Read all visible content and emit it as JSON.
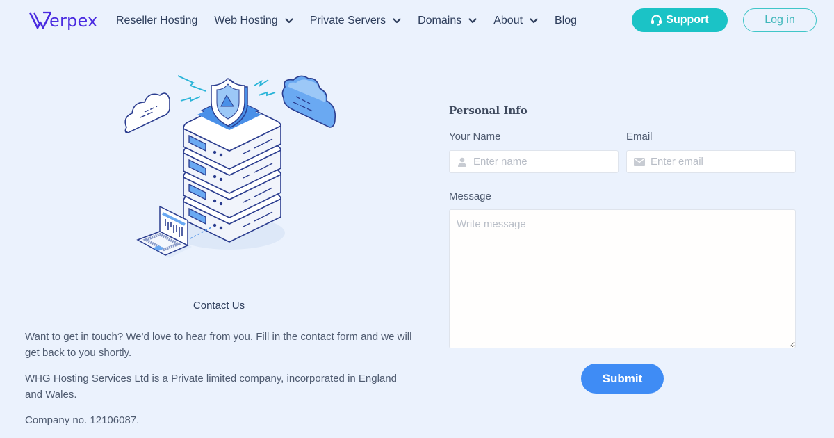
{
  "brand": {
    "logo_text": "erpex",
    "logo_mark": "W",
    "color": "#4a2be0"
  },
  "nav": {
    "items": [
      {
        "label": "Reseller Hosting",
        "has_dropdown": false
      },
      {
        "label": "Web Hosting",
        "has_dropdown": true
      },
      {
        "label": "Private Servers",
        "has_dropdown": true
      },
      {
        "label": "Domains",
        "has_dropdown": true
      },
      {
        "label": "About",
        "has_dropdown": true
      },
      {
        "label": "Blog",
        "has_dropdown": false
      }
    ],
    "support_label": "Support",
    "support_icon": "headset-icon",
    "login_label": "Log in"
  },
  "colors": {
    "background": "#ebf2fd",
    "accent_teal": "#1bc3c6",
    "accent_blue": "#3f8cf5",
    "nav_text": "#2e3e5c"
  },
  "left": {
    "illustration": "server-stack-with-shield-illustration",
    "title": "Contact Us",
    "paragraphs": [
      "Want to get in touch? We'd love to hear from you. Fill in the contact form and we will get back to you shortly.",
      "WHG Hosting Services Ltd is a Private limited company, incorporated in England and Wales.",
      "Company no. 12106087."
    ]
  },
  "form": {
    "heading": "Personal Info",
    "name": {
      "label": "Your Name",
      "placeholder": "Enter name",
      "value": "",
      "icon": "user-icon"
    },
    "email": {
      "label": "Email",
      "placeholder": "Enter email",
      "value": "",
      "icon": "envelope-icon"
    },
    "message": {
      "label": "Message",
      "placeholder": "Write message",
      "value": ""
    },
    "submit_label": "Submit"
  }
}
